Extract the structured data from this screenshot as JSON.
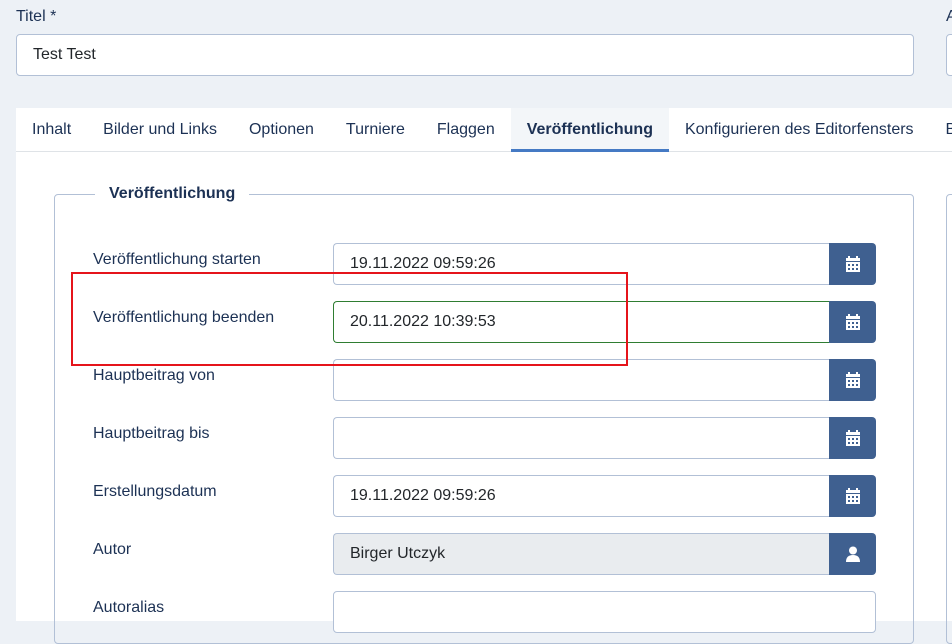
{
  "title_label": "Titel *",
  "title_value": "Test Test",
  "alias_label_partial": "A",
  "tabs": [
    {
      "label": "Inhalt"
    },
    {
      "label": "Bilder und Links"
    },
    {
      "label": "Optionen"
    },
    {
      "label": "Turniere"
    },
    {
      "label": "Flaggen"
    },
    {
      "label": "Veröffentlichung",
      "active": true
    },
    {
      "label": "Konfigurieren des Editorfensters"
    },
    {
      "label": "Be"
    }
  ],
  "fieldset_legend": "Veröffentlichung",
  "fields": [
    {
      "label": "Veröffentlichung starten",
      "value": "19.11.2022 09:59:26",
      "icon": "calendar-icon"
    },
    {
      "label": "Veröffentlichung beenden",
      "value": "20.11.2022 10:39:53",
      "icon": "calendar-icon"
    },
    {
      "label": "Hauptbeitrag von",
      "value": "",
      "icon": "calendar-icon"
    },
    {
      "label": "Hauptbeitrag bis",
      "value": "",
      "icon": "calendar-icon"
    },
    {
      "label": "Erstellungsdatum",
      "value": "19.11.2022 09:59:26",
      "icon": "calendar-icon"
    },
    {
      "label": "Autor",
      "value": "Birger Utczyk",
      "icon": "user-icon"
    },
    {
      "label": "Autoralias",
      "value": ""
    }
  ],
  "colors": {
    "button": "#3f6090",
    "highlight": "#e5141b",
    "valid_border": "#2f7d32"
  }
}
